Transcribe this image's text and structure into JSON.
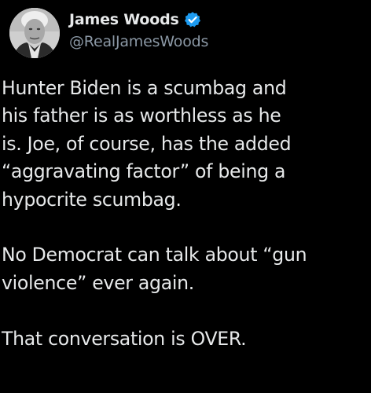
{
  "author": {
    "display_name": "James Woods",
    "handle": "@RealJamesWoods",
    "verified": true,
    "avatar": "portrait-avatar",
    "verified_icon": "verified-badge-icon",
    "verified_color": "#1d9bf0"
  },
  "tweet": {
    "lines": [
      "Hunter Biden is a scumbag and",
      "his father is as worthless as he",
      "is. Joe, of course, has the added",
      "“aggravating factor” of being a",
      "hypocrite scumbag.",
      "No Democrat can talk about “gun",
      "violence” ever again.",
      "That conversation is OVER."
    ]
  },
  "colors": {
    "background": "#000000",
    "text": "#e7e9ea",
    "secondary_text": "#8b98a5"
  }
}
